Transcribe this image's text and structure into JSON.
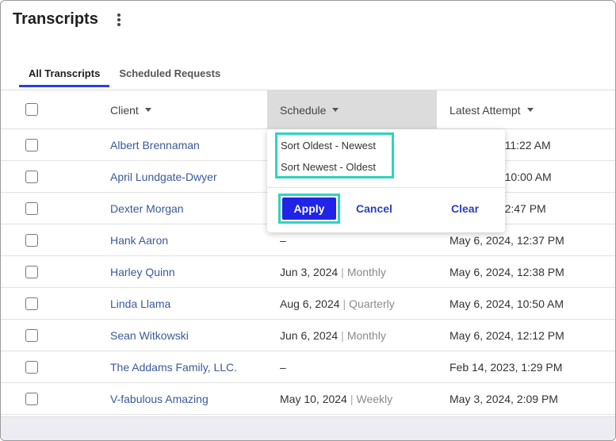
{
  "page": {
    "title": "Transcripts"
  },
  "tabs": [
    {
      "label": "All Transcripts",
      "active": true
    },
    {
      "label": "Scheduled Requests",
      "active": false
    }
  ],
  "columns": {
    "client": "Client",
    "schedule": "Schedule",
    "latest": "Latest Attempt"
  },
  "rows": [
    {
      "client": "Albert Brennaman",
      "date": "",
      "freq": "",
      "latest": "4, 11:22 AM"
    },
    {
      "client": "April Lundgate-Dwyer",
      "date": "",
      "freq": "",
      "latest": "4, 10:00 AM"
    },
    {
      "client": "Dexter Morgan",
      "date": "",
      "freq": "",
      "latest": "4, 2:47 PM"
    },
    {
      "client": "Hank Aaron",
      "date": "–",
      "freq": "",
      "latest": "May 6, 2024, 12:37 PM"
    },
    {
      "client": "Harley Quinn",
      "date": "Jun 3, 2024",
      "freq": "Monthly",
      "latest": "May 6, 2024, 12:38 PM"
    },
    {
      "client": "Linda Llama",
      "date": "Aug 6, 2024",
      "freq": "Quarterly",
      "latest": "May 6, 2024, 10:50 AM"
    },
    {
      "client": "Sean Witkowski",
      "date": "Jun 6, 2024",
      "freq": "Monthly",
      "latest": "May 6, 2024, 12:12 PM"
    },
    {
      "client": "The Addams Family, LLC.",
      "date": "–",
      "freq": "",
      "latest": "Feb 14, 2023, 1:29 PM"
    },
    {
      "client": "V-fabulous Amazing",
      "date": "May 10, 2024",
      "freq": "Weekly",
      "latest": "May 3, 2024, 2:09 PM"
    }
  ],
  "sort_dropdown": {
    "options": [
      "Sort Oldest - Newest",
      "Sort Newest - Oldest"
    ],
    "apply_label": "Apply",
    "cancel_label": "Cancel",
    "clear_label": "Clear"
  },
  "colors": {
    "accent": "#1f24e6",
    "highlight": "#2ed3c0",
    "link": "#3a5a9a",
    "tab_underline": "#2b3fe0"
  },
  "icons": [
    "kebab-menu-icon",
    "caret-down-icon",
    "checkbox-icon"
  ]
}
